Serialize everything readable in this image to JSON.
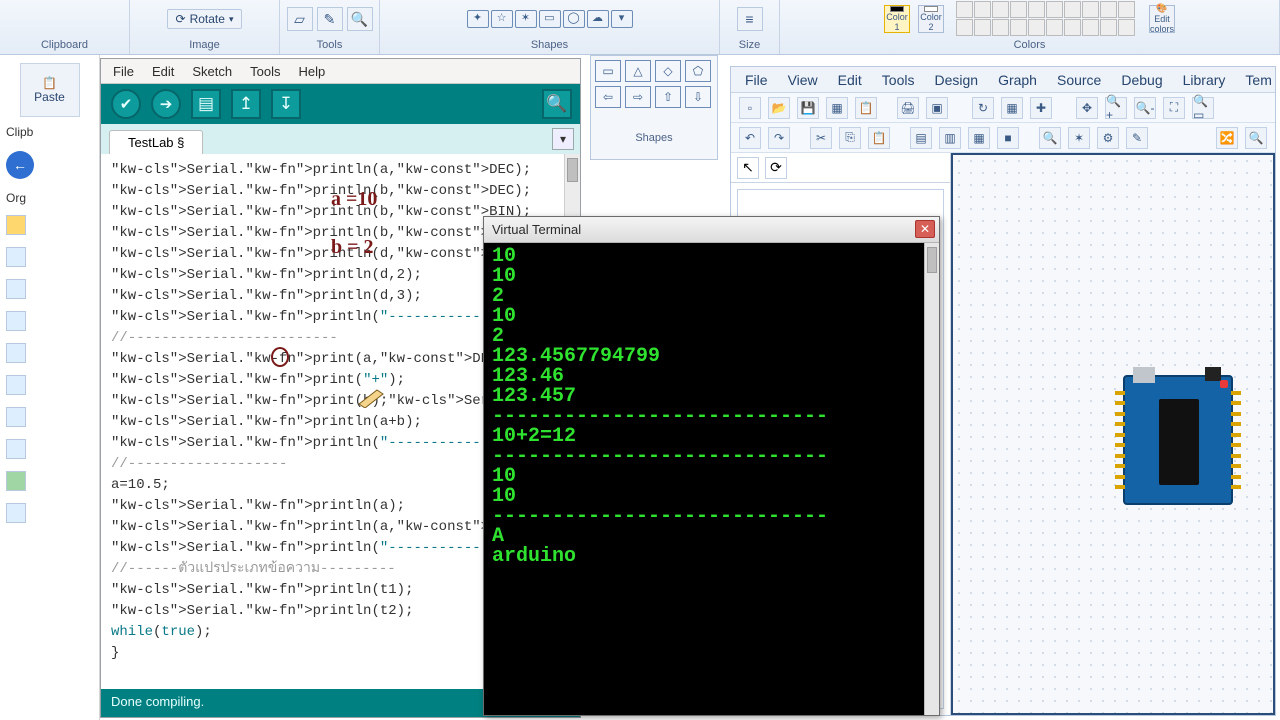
{
  "ribbon": {
    "clipboard_label": "Clipboard",
    "image_label": "Image",
    "rotate_label": "Rotate",
    "tools_label": "Tools",
    "shapes_label": "Shapes",
    "size_label": "Size",
    "colors_label": "Colors",
    "color1_top": "Color",
    "color1_bot": "1",
    "color2_top": "Color",
    "color2_bot": "2",
    "editcolors_top": "Edit",
    "editcolors_bot": "colors",
    "paste_label": "Paste"
  },
  "explorer": {
    "clipboard": "Clipb",
    "organize": "Org"
  },
  "arduino": {
    "menu": [
      "File",
      "Edit",
      "Sketch",
      "Tools",
      "Help"
    ],
    "tab": "TestLab §",
    "status": "Done compiling.",
    "annotations": {
      "a": "a =10",
      "b": "b = 2"
    },
    "code": [
      {
        "t": "dec",
        "txt": "Serial.println(a,DEC);"
      },
      {
        "t": "dec",
        "txt": "Serial.println(b,DEC);"
      },
      {
        "t": "bin",
        "txt": "Serial.println(b,BIN);"
      },
      {
        "t": "hex",
        "txt": "Serial.println(b,HEX);"
      },
      {
        "t": "dec",
        "txt": "Serial.println(d,DEC);"
      },
      {
        "t": "plain",
        "txt": "Serial.println(d,2);"
      },
      {
        "t": "plain",
        "txt": "Serial.println(d,3);"
      },
      {
        "t": "str",
        "txt": "Serial.println(\"--------------------\");"
      },
      {
        "t": "cmt",
        "txt": "//-------------------------"
      },
      {
        "t": "pr",
        "txt": "Serial.print(a,DEC);"
      },
      {
        "t": "ps",
        "txt": "Serial.print(\"+\");"
      },
      {
        "t": "pr2",
        "txt": "Serial.print(b);Serial.print(\"=\");"
      },
      {
        "t": "plain",
        "txt": "Serial.println(a+b);"
      },
      {
        "t": "str",
        "txt": "Serial.println(\"--------------------\");"
      },
      {
        "t": "cmt",
        "txt": "//-------------------"
      },
      {
        "t": "plain",
        "txt": "a=10.5;"
      },
      {
        "t": "plain",
        "txt": "Serial.println(a);"
      },
      {
        "t": "dec",
        "txt": "Serial.println(a,DEC);"
      },
      {
        "t": "str",
        "txt": "Serial.println(\"--------------------\");"
      },
      {
        "t": "cmt",
        "txt": "//------ตัวแปรประเภทข้อความ---------"
      },
      {
        "t": "plain",
        "txt": "Serial.println(t1);"
      },
      {
        "t": "plain",
        "txt": "Serial.println(t2);"
      },
      {
        "t": "while",
        "txt": "while(true);"
      },
      {
        "t": "plain",
        "txt": "}"
      }
    ]
  },
  "shapes_panel_label": "Shapes",
  "proteus": {
    "menu": [
      "File",
      "View",
      "Edit",
      "Tools",
      "Design",
      "Graph",
      "Source",
      "Debug",
      "Library",
      "Tem"
    ]
  },
  "vterm": {
    "title": "Virtual Terminal",
    "lines": [
      "10",
      "10",
      "2",
      "10",
      "2",
      "123.4567794799",
      "123.46",
      "123.457",
      "----------------------------",
      "10+2=12",
      "----------------------------",
      "10",
      "10",
      "----------------------------",
      "A",
      "arduino"
    ]
  }
}
